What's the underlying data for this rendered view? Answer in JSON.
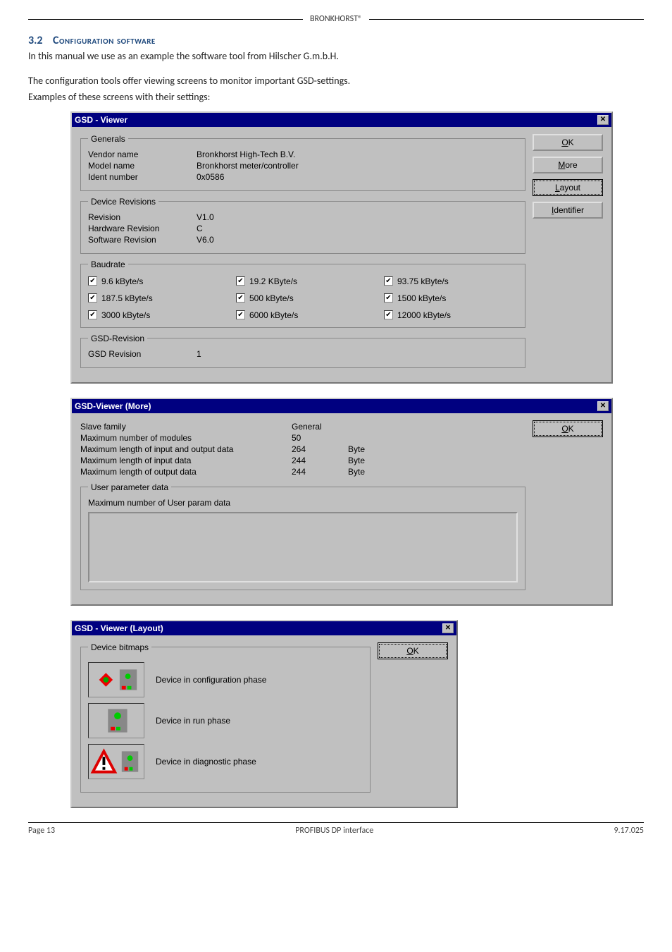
{
  "header": {
    "brand": "BRONKHORST®"
  },
  "section": {
    "number": "3.2",
    "title": "Configuration software"
  },
  "para1": "In this manual we use as an example the software tool from Hilscher G.m.b.H.",
  "para2": "The configuration tools offer viewing screens to monitor important GSD-settings.",
  "para3": "Examples of these screens with their settings:",
  "viewer": {
    "title": "GSD - Viewer",
    "buttons": {
      "ok": "OK",
      "more": "More",
      "layout": "Layout",
      "identifier": "Identifier"
    },
    "generals": {
      "legend": "Generals",
      "vendor_label": "Vendor name",
      "vendor_val": "Bronkhorst High-Tech B.V.",
      "model_label": "Model name",
      "model_val": "Bronkhorst meter/controller",
      "ident_label": "Ident number",
      "ident_val": "0x0586"
    },
    "revisions": {
      "legend": "Device Revisions",
      "rev_label": "Revision",
      "rev_val": "V1.0",
      "hw_label": "Hardware Revision",
      "hw_val": "C",
      "sw_label": "Software Revision",
      "sw_val": "V6.0"
    },
    "baudrate": {
      "legend": "Baudrate",
      "items": [
        "9.6 kByte/s",
        "19.2 KByte/s",
        "93.75 kByte/s",
        "187.5 kByte/s",
        "500 kByte/s",
        "1500 kByte/s",
        "3000 kByte/s",
        "6000 kByte/s",
        "12000 kByte/s"
      ]
    },
    "gsd": {
      "legend": "GSD-Revision",
      "label": "GSD Revision",
      "val": "1"
    }
  },
  "more": {
    "title": "GSD-Viewer (More)",
    "ok": "OK",
    "rows": [
      {
        "label": "Slave family",
        "v1": "General",
        "v2": ""
      },
      {
        "label": "Maximum number of modules",
        "v1": "50",
        "v2": ""
      },
      {
        "label": "Maximum length of input and output data",
        "v1": "264",
        "v2": "Byte"
      },
      {
        "label": "Maximum length of input data",
        "v1": "244",
        "v2": "Byte"
      },
      {
        "label": "Maximum length of output data",
        "v1": "244",
        "v2": "Byte"
      }
    ],
    "user_legend": "User parameter data",
    "user_label": "Maximum number of User param data"
  },
  "layout": {
    "title": "GSD - Viewer (Layout)",
    "ok": "OK",
    "legend": "Device bitmaps",
    "rows": [
      "Device in configuration phase",
      "Device in run phase",
      "Device in diagnostic phase"
    ]
  },
  "footer": {
    "left": "Page 13",
    "center": "PROFIBUS DP interface",
    "right": "9.17.025"
  }
}
